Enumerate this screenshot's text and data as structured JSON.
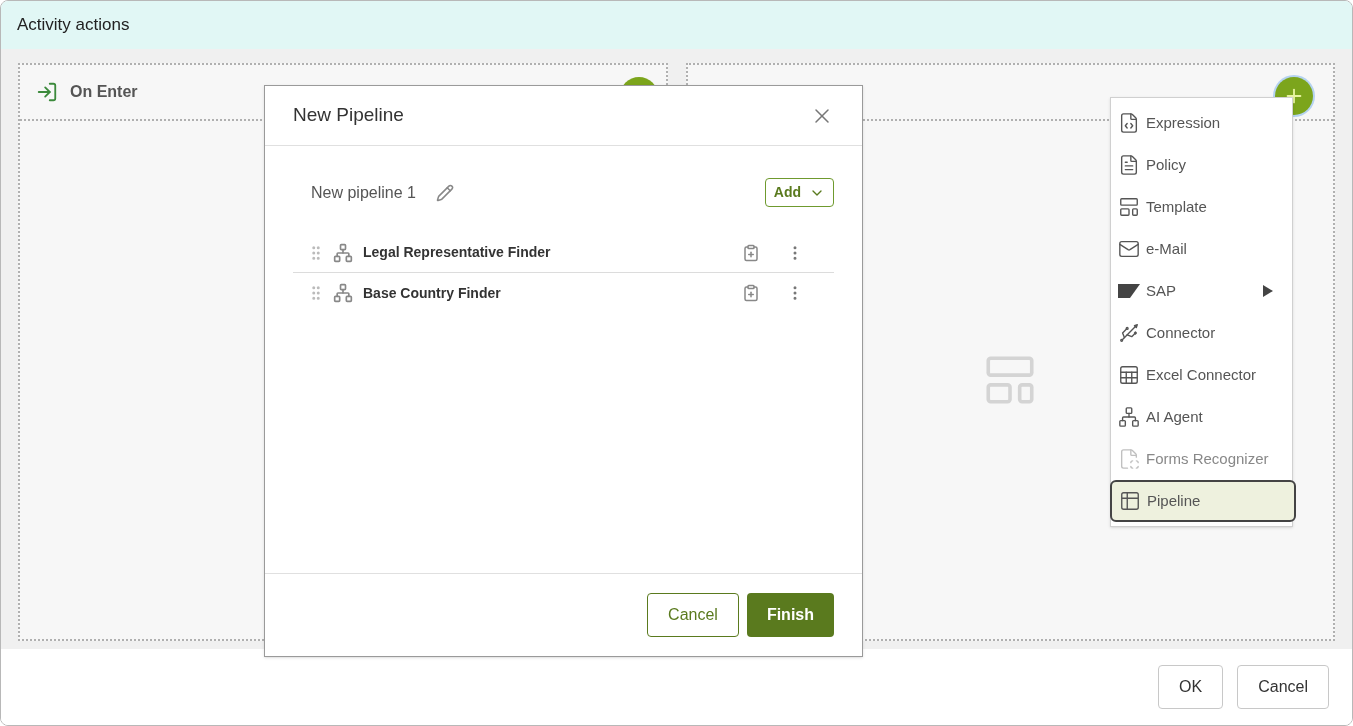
{
  "window": {
    "title": "Activity actions"
  },
  "panels": [
    {
      "kind": "entry",
      "title": "On Enter"
    },
    {
      "kind": "placeholder"
    }
  ],
  "dialog": {
    "title": "New Pipeline",
    "pipeline_name": "New pipeline 1",
    "add_button": "Add",
    "steps": [
      {
        "name": "Legal Representative Finder"
      },
      {
        "name": "Base Country Finder"
      }
    ],
    "buttons": [
      {
        "label": "Cancel",
        "kind": "secondary"
      },
      {
        "label": "Finish",
        "kind": "primary"
      }
    ]
  },
  "menu": [
    {
      "label": "Expression",
      "selected": false,
      "submenu": false,
      "disabled": false
    },
    {
      "label": "Policy",
      "selected": false,
      "submenu": false,
      "disabled": false
    },
    {
      "label": "Template",
      "selected": false,
      "submenu": false,
      "disabled": false
    },
    {
      "label": "e-Mail",
      "selected": false,
      "submenu": false,
      "disabled": false
    },
    {
      "label": "SAP",
      "selected": false,
      "submenu": true,
      "disabled": false
    },
    {
      "label": "Connector",
      "selected": false,
      "submenu": false,
      "disabled": false
    },
    {
      "label": "Excel Connector",
      "selected": false,
      "submenu": false,
      "disabled": false
    },
    {
      "label": "AI Agent",
      "selected": false,
      "submenu": false,
      "disabled": false
    },
    {
      "label": "Forms Recognizer",
      "selected": false,
      "submenu": false,
      "disabled": true
    },
    {
      "label": "Pipeline",
      "selected": true,
      "submenu": false,
      "disabled": false
    }
  ],
  "footer_buttons": [
    "OK",
    "Cancel"
  ]
}
